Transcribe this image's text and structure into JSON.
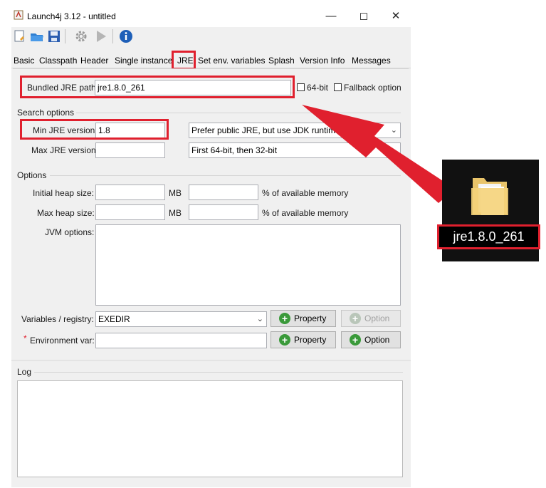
{
  "window": {
    "title": "Launch4j 3.12 - untitled",
    "minimize_icon": "minimize-icon",
    "maximize_icon": "maximize-icon",
    "close_icon": "close-icon"
  },
  "toolbar": {
    "icons": [
      "new-config-icon",
      "open-icon",
      "save-icon",
      "build-gear-icon",
      "run-icon",
      "about-info-icon"
    ]
  },
  "tabs": [
    {
      "label": "Basic"
    },
    {
      "label": "Classpath"
    },
    {
      "label": "Header"
    },
    {
      "label": "Single instance"
    },
    {
      "label": "JRE"
    },
    {
      "label": "Set env. variables"
    },
    {
      "label": "Splash"
    },
    {
      "label": "Version Info"
    },
    {
      "label": "Messages"
    }
  ],
  "jre": {
    "bundled_label": "Bundled JRE path:",
    "bundled_value": "jre1.8.0_261",
    "bit64_label": "64-bit",
    "fallback_label": "Fallback option",
    "search_section": "Search options",
    "min_label": "Min JRE version:",
    "min_value": "1.8",
    "max_label": "Max JRE version:",
    "max_value": "",
    "prefer_select": "Prefer public JRE, but use JDK runtime",
    "arch_select": "First 64-bit, then 32-bit",
    "options_section": "Options",
    "initial_heap_label": "Initial heap size:",
    "max_heap_label": "Max heap size:",
    "mb": "MB",
    "pct_label": "% of available memory",
    "jvm_label": "JVM options:",
    "vars_label": "Variables / registry:",
    "vars_value": "EXEDIR",
    "env_star": "*",
    "env_label": "Environment var:",
    "property_btn": "Property",
    "option_btn": "Option"
  },
  "log": {
    "label": "Log"
  },
  "folder": {
    "name": "jre1.8.0_261"
  },
  "annotation_color": "#e0202e"
}
